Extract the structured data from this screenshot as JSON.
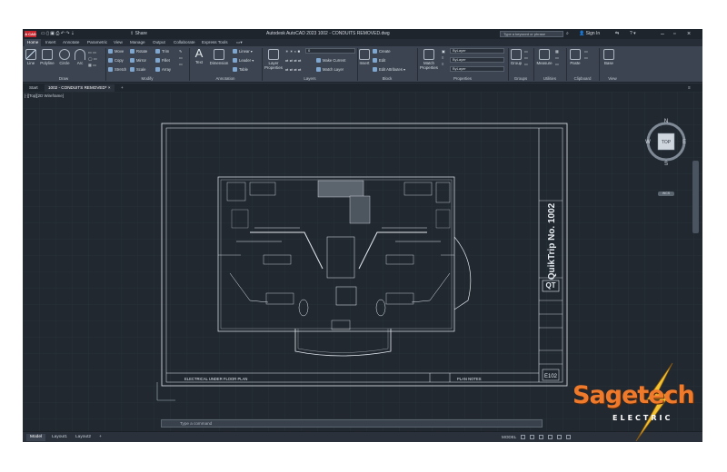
{
  "titlebar": {
    "logo": "A CAD",
    "share": "Share",
    "title": "Autodesk AutoCAD 2023    1002 - CONDUITS REMOVED.dwg",
    "search_placeholder": "Type a keyword or phrase",
    "signin": "Sign In"
  },
  "ribbon_tabs": [
    "Home",
    "Insert",
    "Annotate",
    "Parametric",
    "View",
    "Manage",
    "Output",
    "Collaborate",
    "Express Tools"
  ],
  "ribbon": {
    "draw": {
      "line": "Line",
      "polyline": "Polyline",
      "circle": "Circle",
      "arc": "Arc",
      "title": "Draw"
    },
    "modify": {
      "move": "Move",
      "rotate": "Rotate",
      "trim": "Trim",
      "copy": "Copy",
      "mirror": "Mirror",
      "fillet": "Fillet",
      "stretch": "Stretch",
      "scale": "Scale",
      "array": "Array",
      "title": "Modify"
    },
    "annotation": {
      "text": "Text",
      "dimension": "Dimension",
      "linear": "Linear",
      "leader": "Leader",
      "table": "Table",
      "title": "Annotation"
    },
    "layers": {
      "properties": "Layer Properties",
      "make_current": "Make Current",
      "match_layer": "Match Layer",
      "title": "Layers",
      "current": "0"
    },
    "block": {
      "insert": "Insert",
      "create": "Create",
      "edit": "Edit",
      "edit_attributes": "Edit Attributes",
      "title": "Block"
    },
    "properties": {
      "match": "Match Properties",
      "bylayer1": "ByLayer",
      "bylayer2": "ByLayer",
      "bylayer3": "ByLayer",
      "title": "Properties"
    },
    "groups": {
      "group": "Group",
      "title": "Groups"
    },
    "utilities": {
      "measure": "Measure",
      "title": "Utilities"
    },
    "clipboard": {
      "paste": "Paste",
      "title": "Clipboard"
    },
    "view": {
      "base": "Base",
      "title": "View"
    }
  },
  "filetabs": {
    "start": "Start",
    "active": "1002 - CONDUITS REMOVED*",
    "add": "+"
  },
  "viewport": {
    "label": "[-][Top][2D Wireframe]",
    "plan_title": "ELECTRICAL UNDER FLOOR PLAN",
    "plan_notes": "PLAN NOTES",
    "sheet_title": "QuikTrip No. 1002",
    "sheet_no": "E102",
    "logo": "QT",
    "viewcube": {
      "top": "TOP",
      "n": "N",
      "s": "S",
      "e": "E",
      "w": "W",
      "wcs": "WCS"
    }
  },
  "cmdline": {
    "placeholder": "Type a command"
  },
  "statusbar": {
    "tabs": [
      "Model",
      "Layout1",
      "Layout2"
    ],
    "add": "+",
    "model": "MODEL"
  },
  "brand": {
    "name": "Sagetech",
    "sub": "ELECTRIC"
  },
  "colors": {
    "bg": "#212830",
    "ribbon": "#3b4450",
    "lines": "#e6ebf0",
    "accent": "#f07a2c"
  }
}
